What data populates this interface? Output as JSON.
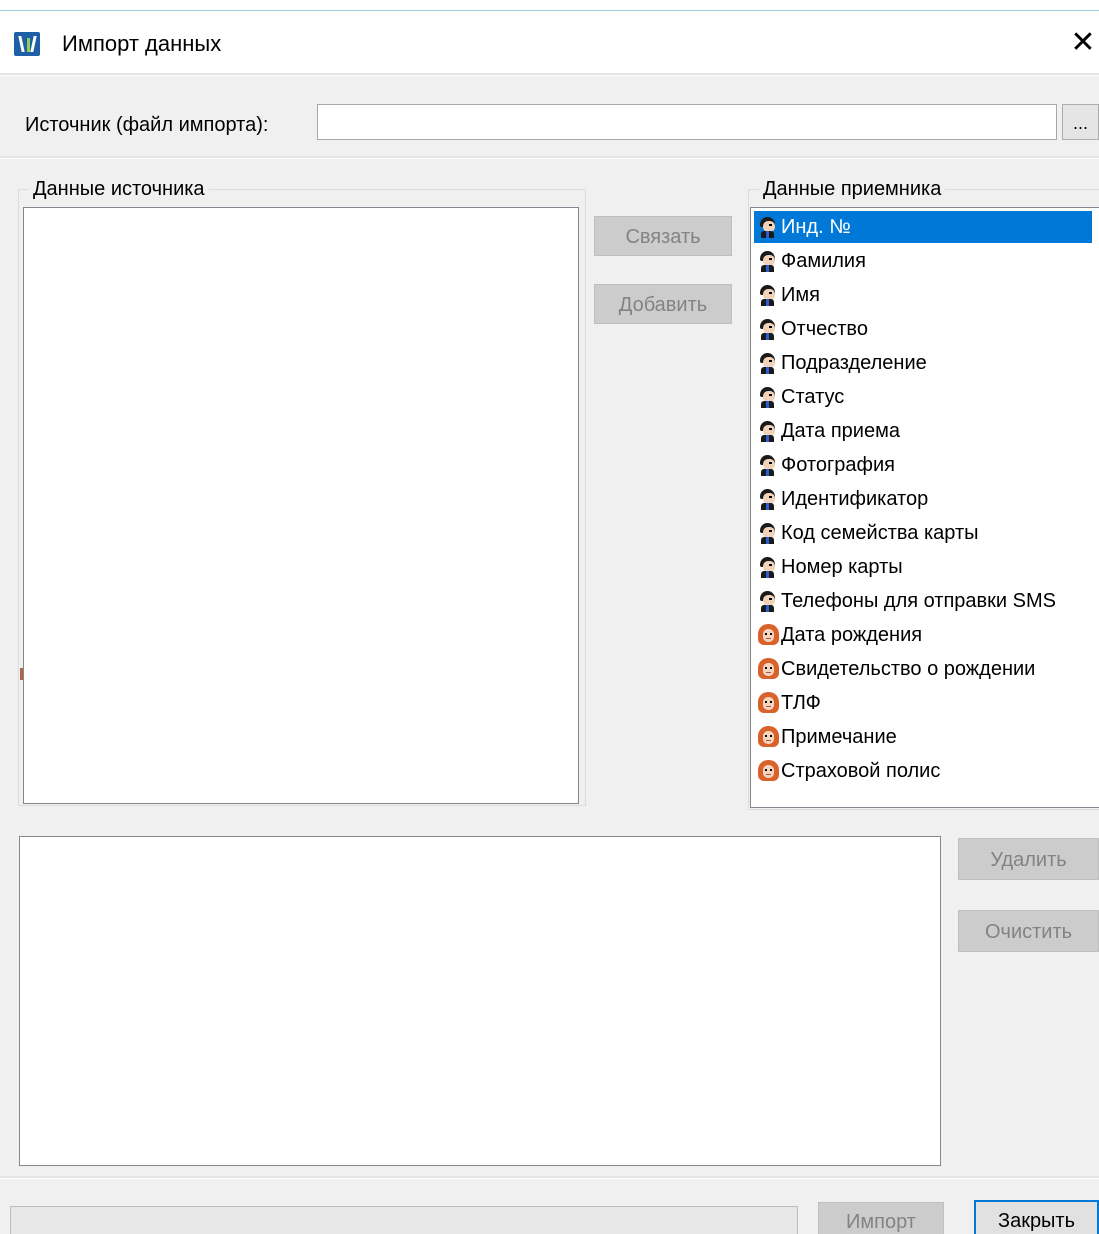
{
  "window": {
    "title": "Импорт данных",
    "close_glyph": "✕"
  },
  "source_file": {
    "label": "Источник (файл импорта):",
    "value": "",
    "placeholder": "",
    "browse_label": "..."
  },
  "source_data": {
    "legend": "Данные источника",
    "items": []
  },
  "dest_data": {
    "legend": "Данные приемника",
    "selected_index": 0,
    "items": [
      {
        "label": "Инд. №",
        "icon": "person-male-icon"
      },
      {
        "label": "Фамилия",
        "icon": "person-male-icon"
      },
      {
        "label": "Имя",
        "icon": "person-male-icon"
      },
      {
        "label": "Отчество",
        "icon": "person-male-icon"
      },
      {
        "label": "Подразделение",
        "icon": "person-male-icon"
      },
      {
        "label": "Статус",
        "icon": "person-male-icon"
      },
      {
        "label": "Дата приема",
        "icon": "person-male-icon"
      },
      {
        "label": "Фотография",
        "icon": "person-male-icon"
      },
      {
        "label": "Идентификатор",
        "icon": "person-male-icon"
      },
      {
        "label": "Код семейства карты",
        "icon": "person-male-icon"
      },
      {
        "label": "Номер карты",
        "icon": "person-male-icon"
      },
      {
        "label": "Телефоны для отправки SMS",
        "icon": "person-male-icon"
      },
      {
        "label": "Дата рождения",
        "icon": "person-female-icon"
      },
      {
        "label": "Свидетельство о рождении",
        "icon": "person-female-icon"
      },
      {
        "label": "ТЛФ",
        "icon": "person-female-icon"
      },
      {
        "label": "Примечание",
        "icon": "person-female-icon"
      },
      {
        "label": "Страховой полис",
        "icon": "person-female-icon"
      }
    ]
  },
  "buttons": {
    "link": "Связать",
    "add": "Добавить",
    "delete": "Удалить",
    "clear": "Очистить",
    "import": "Импорт",
    "close": "Закрыть"
  },
  "mapping_list": {
    "items": []
  },
  "status": {
    "text": ""
  },
  "colors": {
    "selection": "#0078d7",
    "disabled_button_bg": "#cccccc",
    "disabled_button_text": "#838383",
    "window_bg": "#f0f0f0"
  }
}
